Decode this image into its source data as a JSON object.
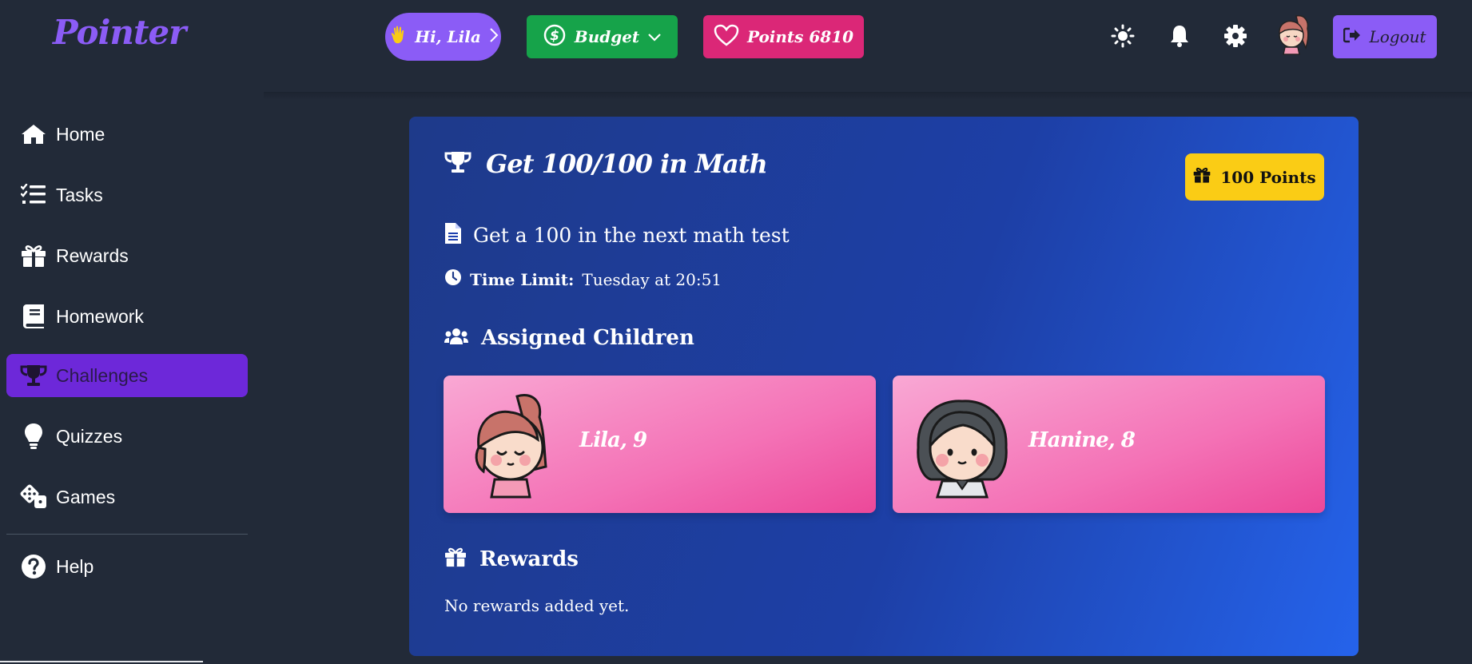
{
  "app": {
    "logo": "Pointer"
  },
  "header": {
    "greeting": "Hi, Lila",
    "budget_label": "Budget",
    "points_label": "Points 6810",
    "logout_label": "Logout"
  },
  "sidebar": {
    "items": [
      {
        "label": "Home",
        "icon": "home-icon"
      },
      {
        "label": "Tasks",
        "icon": "tasks-icon"
      },
      {
        "label": "Rewards",
        "icon": "gift-icon"
      },
      {
        "label": "Homework",
        "icon": "book-icon"
      },
      {
        "label": "Challenges",
        "icon": "trophy-icon",
        "active": true
      },
      {
        "label": "Quizzes",
        "icon": "lightbulb-icon"
      },
      {
        "label": "Games",
        "icon": "dice-icon"
      }
    ],
    "help_label": "Help"
  },
  "challenge": {
    "title": "Get 100/100 in Math",
    "points_badge": "100 Points",
    "description": "Get a 100 in the next math test",
    "time_limit_label": "Time Limit:",
    "time_limit_value": "Tuesday at 20:51",
    "assigned_heading": "Assigned Children",
    "children": [
      {
        "name": "Lila, 9"
      },
      {
        "name": "Hanine, 8"
      }
    ],
    "rewards_heading": "Rewards",
    "rewards_empty": "No rewards added yet."
  },
  "colors": {
    "accent": "#8b5cf6",
    "budget": "#16a34a",
    "points": "#db2777",
    "active_nav": "#6d28d9",
    "badge": "#facc15"
  }
}
